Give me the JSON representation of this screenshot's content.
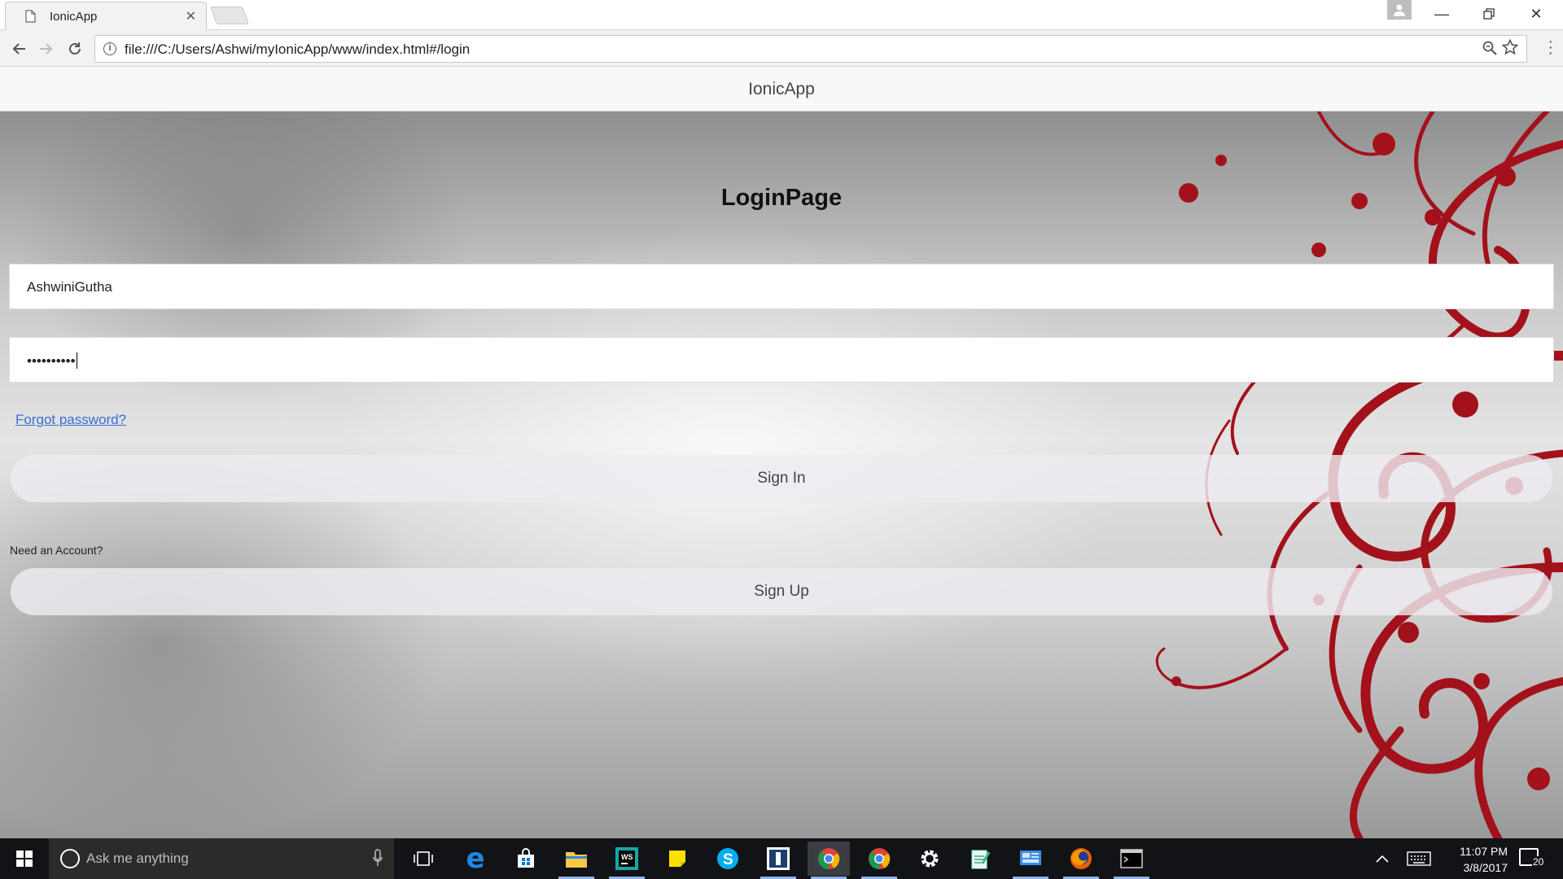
{
  "browser": {
    "tab_title": "IonicApp",
    "url": "file:///C:/Users/Ashwi/myIonicApp/www/index.html#/login"
  },
  "app": {
    "header_title": "IonicApp",
    "page_title": "LoginPage",
    "username_value": "AshwiniGutha",
    "password_value": "••••••••••",
    "forgot_link": "Forgot password?",
    "sign_in_label": "Sign In",
    "need_account_text": "Need an Account?",
    "sign_up_label": "Sign Up"
  },
  "taskbar": {
    "search_placeholder": "Ask me anything",
    "time": "11:07 PM",
    "date": "3/8/2017",
    "notification_count": "20",
    "pinned": [
      "task-view",
      "edge",
      "store",
      "file-explorer",
      "webstorm",
      "sticky-notes",
      "skype",
      "dev-tool",
      "chrome",
      "chrome",
      "settings",
      "notepad",
      "remote-desktop",
      "firefox",
      "terminal"
    ]
  },
  "colors": {
    "accent_red": "#a3111b",
    "link_blue": "#3a6fd0",
    "taskbar": "#111317"
  }
}
